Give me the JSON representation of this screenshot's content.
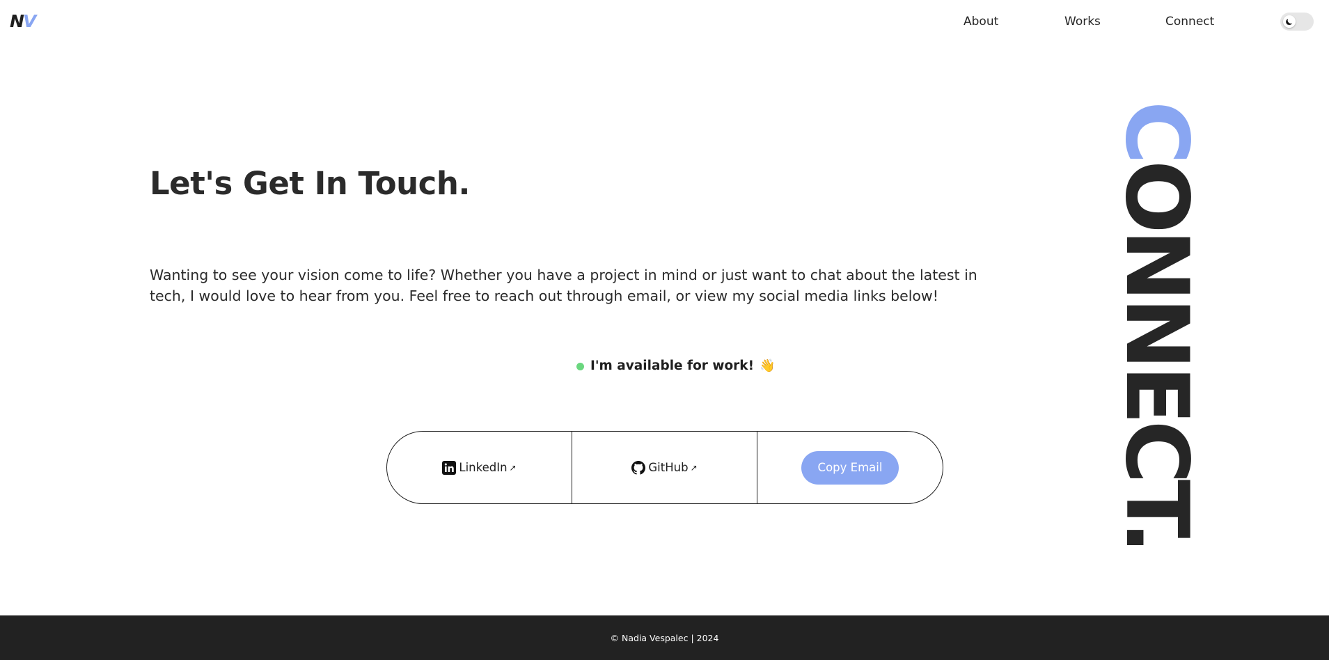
{
  "nav": {
    "logo": {
      "first": "N",
      "second": "V"
    },
    "links": [
      "About",
      "Works",
      "Connect"
    ],
    "theme_toggle_icon": "moon-icon"
  },
  "hero": {
    "title": "Let's Get In Touch.",
    "intro": "Wanting to see your vision come to life? Whether you have a project in mind or just want to chat about the latest in tech, I would love to hear from you. Feel free to reach out through email, or view my social media links below!"
  },
  "availability": {
    "text": "I'm available for work!",
    "emoji": "👋",
    "status_color": "#6ad77f"
  },
  "contact": {
    "linkedin_label": "LinkedIn",
    "linkedin_icon": "linkedin-icon",
    "github_label": "GitHub",
    "github_icon": "github-icon",
    "external_arrow": "↗",
    "copy_email_label": "Copy Email"
  },
  "side_title": {
    "first_letter": "C",
    "rest": "ONNECT."
  },
  "footer": {
    "text": "© Nadia Vespalec | 2024"
  },
  "colors": {
    "accent": "#89a6f2",
    "text": "#262626",
    "footer_bg": "#222222"
  }
}
